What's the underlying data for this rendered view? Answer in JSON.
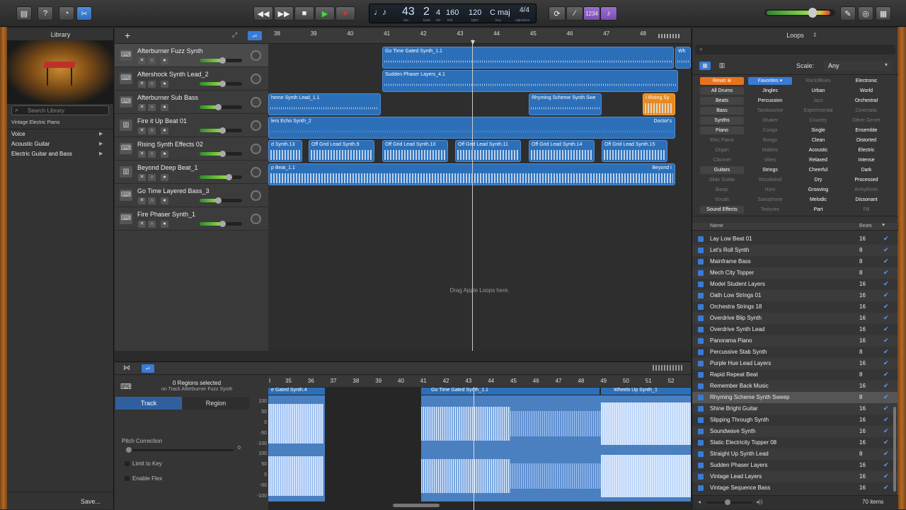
{
  "toolbar": {
    "lcd": {
      "bar": "43",
      "beat": "2",
      "div": "4",
      "tick": "160",
      "bpm": "120",
      "key": "C maj",
      "sig": "4/4",
      "sub_bar": "bar",
      "sub_beat": "beat",
      "sub_div": "div",
      "sub_tick": "tick",
      "sub_bpm": "bpm",
      "sub_key": "key",
      "sub_sig": "signature"
    },
    "count_in": "1234"
  },
  "library": {
    "title": "Library",
    "search_placeholder": "Search Library",
    "patch": "Vintage Electric Piano",
    "categories": [
      "Voice",
      "Acoustic Guitar",
      "Electric Guitar and Bass"
    ],
    "save_label": "Save..."
  },
  "tracks": [
    {
      "name": "Afterburner Fuzz Synth",
      "vol": 0.55
    },
    {
      "name": "Aftershock Synth Lead_2",
      "vol": 0.55
    },
    {
      "name": "Afterburner Sub Bass",
      "vol": 0.45
    },
    {
      "name": "Fire it Up Beat 01",
      "vol": 0.55
    },
    {
      "name": "Rising Synth Effects 02",
      "vol": 0.55
    },
    {
      "name": "Beyond Deep Beat_1",
      "vol": 0.7
    },
    {
      "name": "Go Time Layered Bass_3",
      "vol": 0.45
    },
    {
      "name": "Fire Phaser Synth_1",
      "vol": 0.55
    }
  ],
  "ruler": [
    "38",
    "39",
    "40",
    "41",
    "42",
    "43",
    "44",
    "45",
    "46",
    "47",
    "48"
  ],
  "regions": {
    "r1": "Go Time Gated Synth_1.1",
    "r1b": "Wh",
    "r2": "Sudden Phaser Layers_4.1",
    "r3a": "heme Synth Lead_1.1",
    "r3b": "Rhyming Scheme Synth Swe",
    "r3c": "I Rising Sy",
    "r4a": "lers Echo Synth_2",
    "r4b": "Doctor's",
    "r5": [
      "d Synth.13",
      "Off Grid Lead Synth.9",
      "Off Grid Lead Synth.10",
      "Off Grid Lead Synth.11",
      "Off Grid Lead Synth.14",
      "Off Grid Lead Synth.15"
    ],
    "r6a": "p Beat_1.1",
    "r6b": "Beyond I"
  },
  "drag_hint": "Drag Apple Loops here.",
  "editor": {
    "regions_selected": "0 Regions selected",
    "on_track": "on Track Afterburner Fuzz Synth",
    "tab_track": "Track",
    "tab_region": "Region",
    "pitch_correction": "Pitch Correction",
    "pitch_value": "0",
    "limit_to_key": "Limit to Key",
    "enable_flex": "Enable Flex",
    "ruler": [
      "35",
      "36",
      "37",
      "38",
      "39",
      "40",
      "41",
      "42",
      "43",
      "44",
      "45",
      "46",
      "47",
      "48",
      "49",
      "50",
      "51",
      "52"
    ],
    "ruler_start": "I",
    "region_a": "e Gated Synth.4",
    "region_b": "Go Time Gated Synth_1.1",
    "region_c": "Wheels Up Synth_1",
    "scale": [
      "100",
      "50",
      "0",
      "-50",
      "-100",
      "100",
      "50",
      "0",
      "-50",
      "-100"
    ]
  },
  "loops": {
    "title": "Loops",
    "scale_label": "Scale:",
    "scale_value": "Any",
    "reset": "Reset",
    "favorites": "Favorites",
    "kw": [
      [
        "Rock/Blues",
        "Electronic"
      ],
      [
        "All Drums",
        "Jingles",
        "Urban",
        "World"
      ],
      [
        "Beats",
        "Percussion",
        "Jazz",
        "Orchestral"
      ],
      [
        "Bass",
        "Tambourine",
        "Experimental",
        "Cinematic"
      ],
      [
        "Synths",
        "Shaker",
        "Country",
        "Other Genre"
      ],
      [
        "Piano",
        "Conga",
        "Single",
        "Ensemble"
      ],
      [
        "Elec Piano",
        "Bongo",
        "Clean",
        "Distorted"
      ],
      [
        "Organ",
        "Mallets",
        "Acoustic",
        "Electric"
      ],
      [
        "Clavinet",
        "Vibes",
        "Relaxed",
        "Intense"
      ],
      [
        "Guitars",
        "Strings",
        "Cheerful",
        "Dark"
      ],
      [
        "Slide Guitar",
        "Woodwind",
        "Dry",
        "Processed"
      ],
      [
        "Banjo",
        "Horn",
        "Grooving",
        "Arrhythmic"
      ],
      [
        "Vocals",
        "Saxophone",
        "Melodic",
        "Dissonant"
      ],
      [
        "Sound Effects",
        "Textures",
        "Part",
        "Fill"
      ]
    ],
    "col_name": "Name",
    "col_beats": "Beats",
    "items": [
      [
        "Lay Low Beat 01",
        "16"
      ],
      [
        "Let's Roll Synth",
        "8"
      ],
      [
        "Mainframe Bass",
        "8"
      ],
      [
        "Mech City Topper",
        "8"
      ],
      [
        "Model Student Layers",
        "16"
      ],
      [
        "Oath Low Strings 01",
        "16"
      ],
      [
        "Orchestra Strings 18",
        "16"
      ],
      [
        "Overdrive Blip Synth",
        "16"
      ],
      [
        "Overdrive Synth Lead",
        "16"
      ],
      [
        "Panorama Piano",
        "16"
      ],
      [
        "Percussive Stab Synth",
        "8"
      ],
      [
        "Purple Hue Lead Layers",
        "16"
      ],
      [
        "Rapid Repeat Beat",
        "8"
      ],
      [
        "Remember Back Music",
        "16"
      ],
      [
        "Rhyming Scheme Synth Sweep",
        "8"
      ],
      [
        "Shine Bright Guitar",
        "16"
      ],
      [
        "Slipping Through Synth",
        "16"
      ],
      [
        "Soundwave Synth",
        "16"
      ],
      [
        "Static Electricity Topper 08",
        "16"
      ],
      [
        "Straight Up Synth Lead",
        "8"
      ],
      [
        "Sudden Phaser Layers",
        "16"
      ],
      [
        "Vintage Lead Layers",
        "16"
      ],
      [
        "Vintage Sequence Bass",
        "16"
      ]
    ],
    "count": "70 items"
  },
  "colors": {
    "accent": "#3a7bd5",
    "region": "#2c6fb9",
    "orange": "#e88a1e"
  }
}
